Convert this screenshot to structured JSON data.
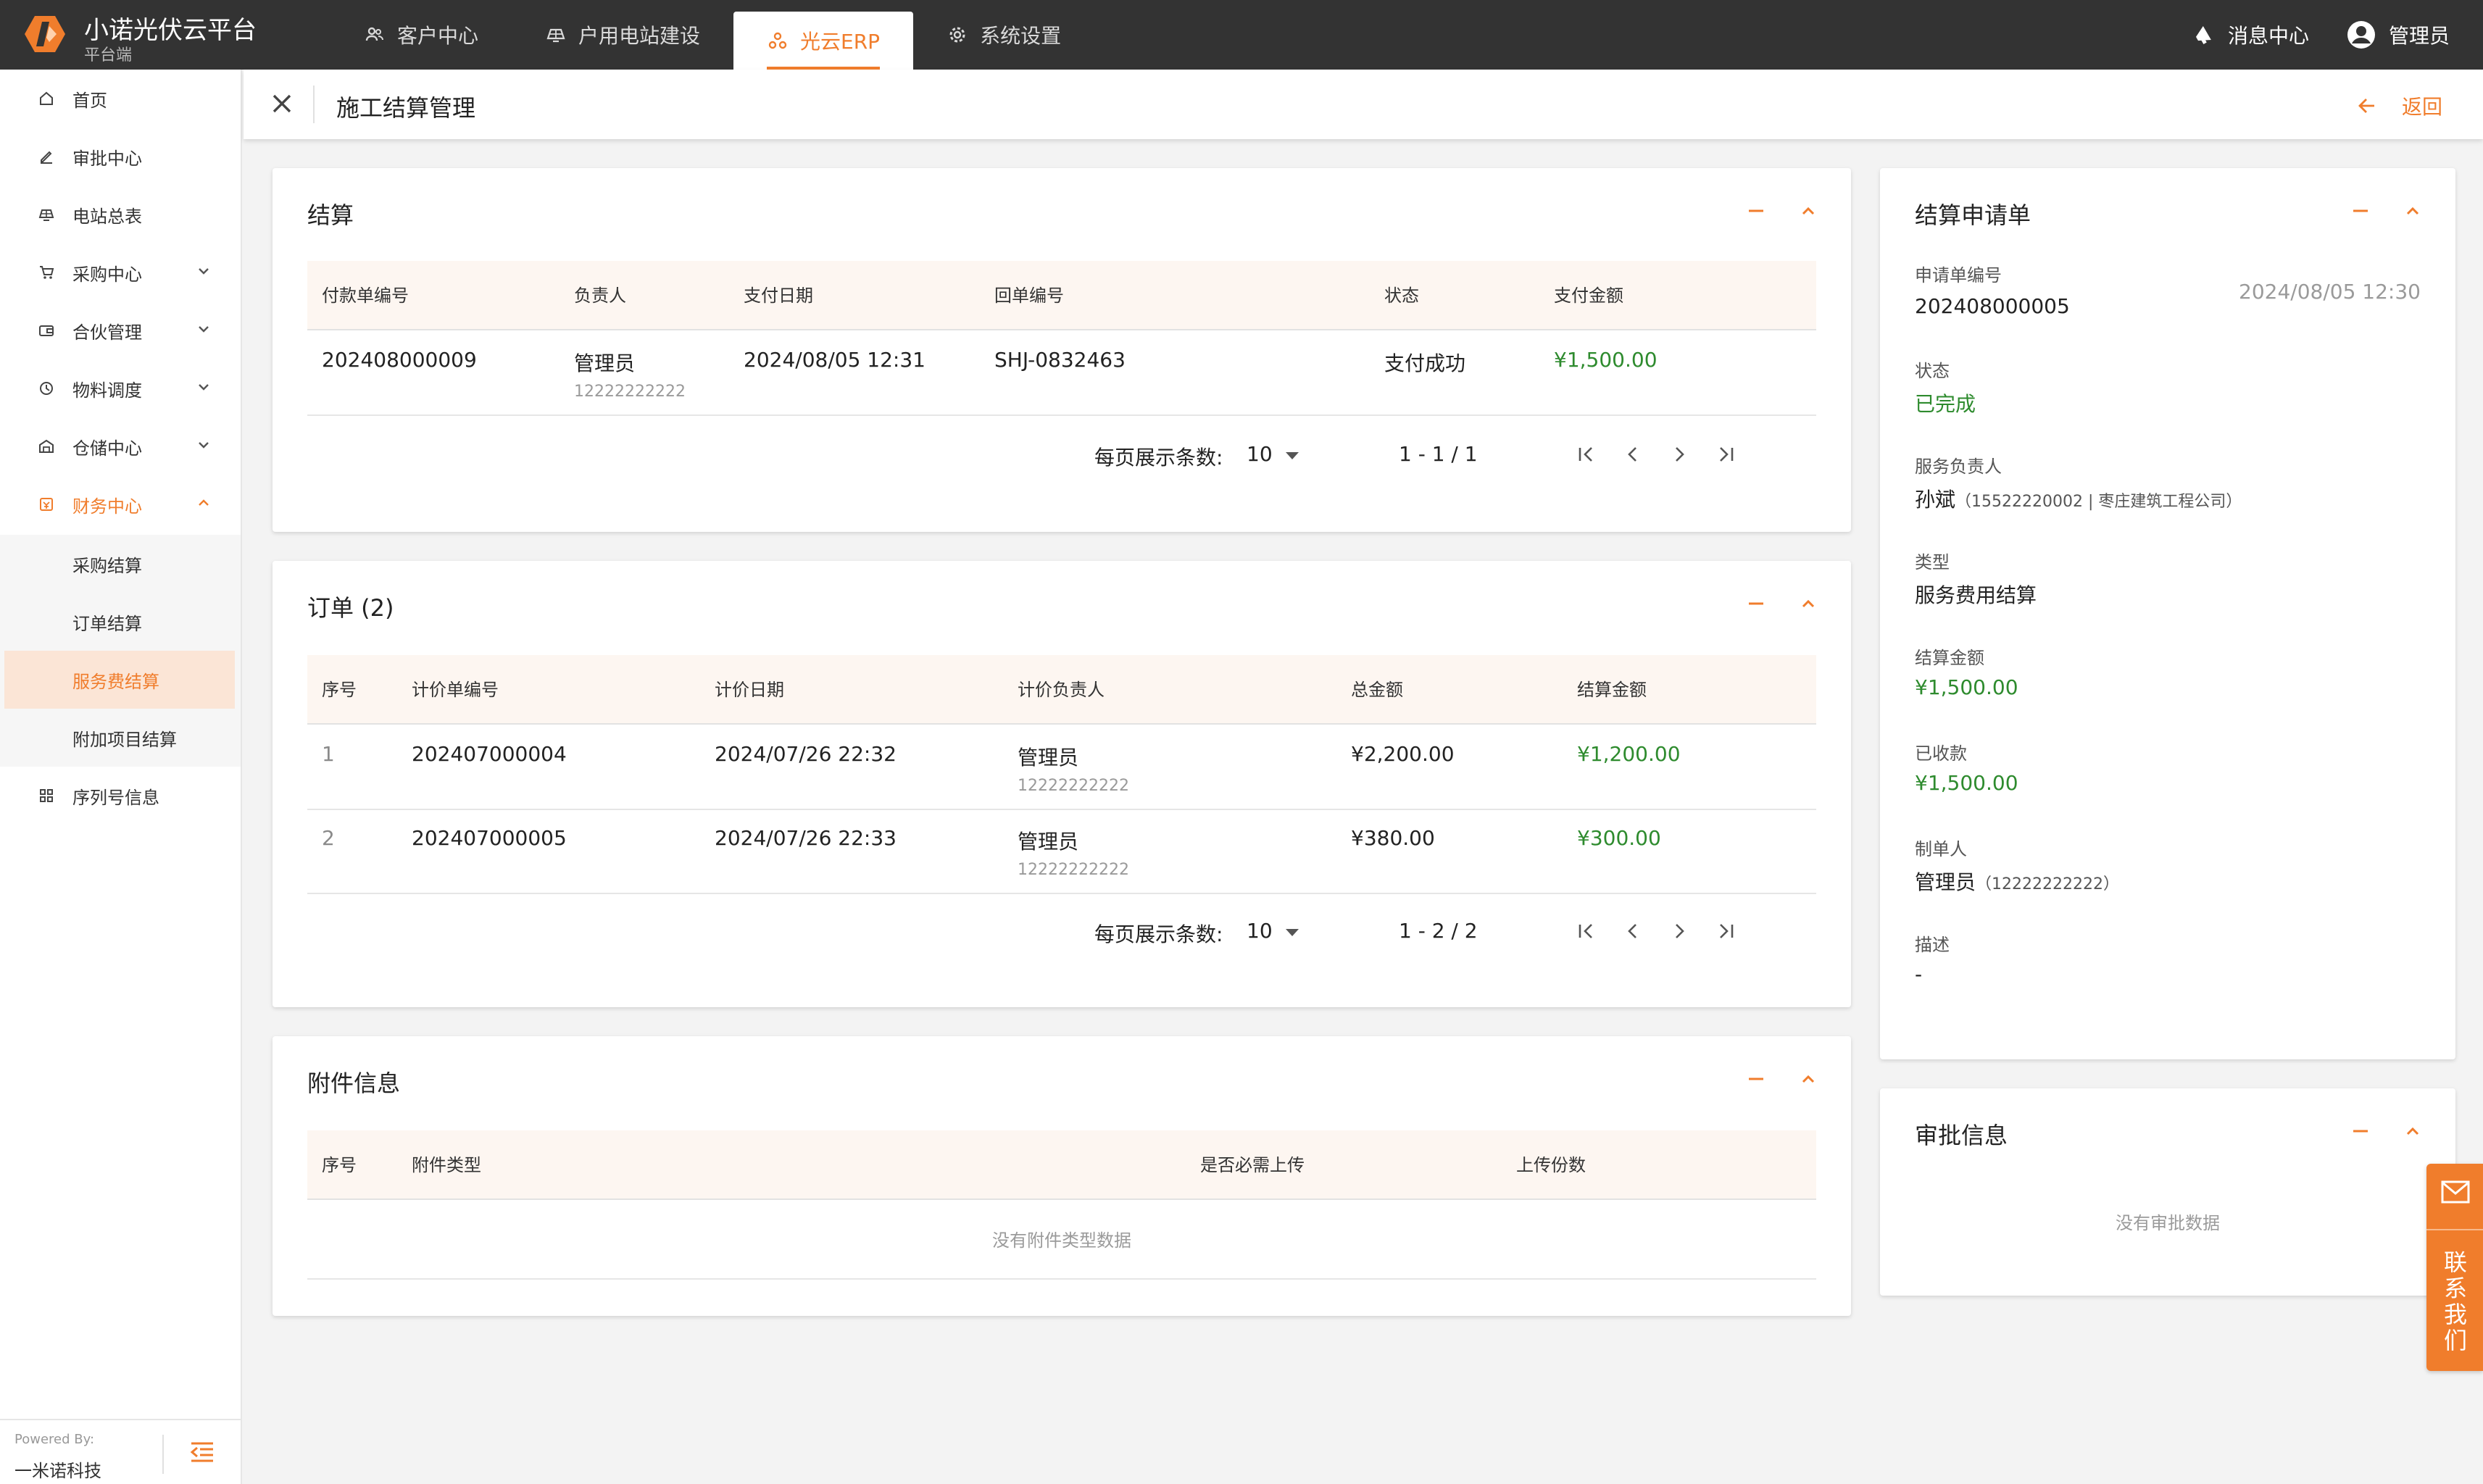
{
  "header": {
    "brand_title": "小诺光伏云平台",
    "brand_subtitle": "平台端",
    "nav": [
      {
        "label": "客户中心",
        "icon": "users-icon"
      },
      {
        "label": "户用电站建设",
        "icon": "solar-panel-icon"
      },
      {
        "label": "光云ERP",
        "icon": "cluster-icon",
        "active": true
      },
      {
        "label": "系统设置",
        "icon": "gear-icon"
      }
    ],
    "messages_label": "消息中心",
    "user_label": "管理员",
    "accent_color": "#f07d2c",
    "bar_color": "#333333"
  },
  "sidebar": {
    "items": [
      {
        "label": "首页",
        "icon": "home-icon"
      },
      {
        "label": "审批中心",
        "icon": "pen-icon"
      },
      {
        "label": "电站总表",
        "icon": "solar-panel-icon"
      },
      {
        "label": "采购中心",
        "icon": "cart-icon"
      },
      {
        "label": "合伙管理",
        "icon": "wallet-icon"
      },
      {
        "label": "物料调度",
        "icon": "dispatch-icon"
      },
      {
        "label": "仓储中心",
        "icon": "warehouse-icon"
      },
      {
        "label": "财务中心",
        "icon": "finance-icon"
      },
      {
        "label": "序列号信息",
        "icon": "grid-icon"
      }
    ],
    "finance_sub": [
      "采购结算",
      "订单结算",
      "服务费结算",
      "附加项目结算"
    ],
    "powered_by": "Powered By:",
    "company": "一米诺科技"
  },
  "page": {
    "title": "施工结算管理",
    "back_label": "返回"
  },
  "settlement": {
    "title": "结算",
    "columns": [
      "付款单编号",
      "负责人",
      "支付日期",
      "回单编号",
      "状态",
      "支付金额"
    ],
    "rows": [
      {
        "no": "202408000009",
        "owner": "管理员",
        "owner_phone": "12222222222",
        "date": "2024/08/05 12:31",
        "receipt": "SHJ-0832463",
        "status": "支付成功",
        "amount": "¥1,500.00"
      }
    ],
    "pager": {
      "label": "每页展示条数:",
      "size": "10",
      "range": "1 - 1 / 1"
    }
  },
  "orders": {
    "title": "订单 (2)",
    "columns": [
      "序号",
      "计价单编号",
      "计价日期",
      "计价负责人",
      "总金额",
      "结算金额"
    ],
    "rows": [
      {
        "idx": "1",
        "no": "202407000004",
        "date": "2024/07/26 22:32",
        "owner": "管理员",
        "owner_phone": "12222222222",
        "total": "¥2,200.00",
        "settle": "¥1,200.00"
      },
      {
        "idx": "2",
        "no": "202407000005",
        "date": "2024/07/26 22:33",
        "owner": "管理员",
        "owner_phone": "12222222222",
        "total": "¥380.00",
        "settle": "¥300.00"
      }
    ],
    "pager": {
      "label": "每页展示条数:",
      "size": "10",
      "range": "1 - 2 / 2"
    }
  },
  "attachments": {
    "title": "附件信息",
    "columns": [
      "序号",
      "附件类型",
      "是否必需上传",
      "上传份数"
    ],
    "empty": "没有附件类型数据"
  },
  "application": {
    "title": "结算申请单",
    "no_label": "申请单编号",
    "no": "202408000005",
    "time": "2024/08/05 12:30",
    "status_label": "状态",
    "status": "已完成",
    "service_owner_label": "服务负责人",
    "service_owner": "孙斌",
    "service_owner_detail": "（15522220002 | 枣庄建筑工程公司）",
    "type_label": "类型",
    "type": "服务费用结算",
    "amount_label": "结算金额",
    "amount": "¥1,500.00",
    "received_label": "已收款",
    "received": "¥1,500.00",
    "maker_label": "制单人",
    "maker": "管理员",
    "maker_detail": "（12222222222）",
    "desc_label": "描述",
    "desc": "-"
  },
  "approval": {
    "title": "审批信息",
    "empty": "没有审批数据"
  },
  "contact": {
    "label": "联系我们"
  }
}
